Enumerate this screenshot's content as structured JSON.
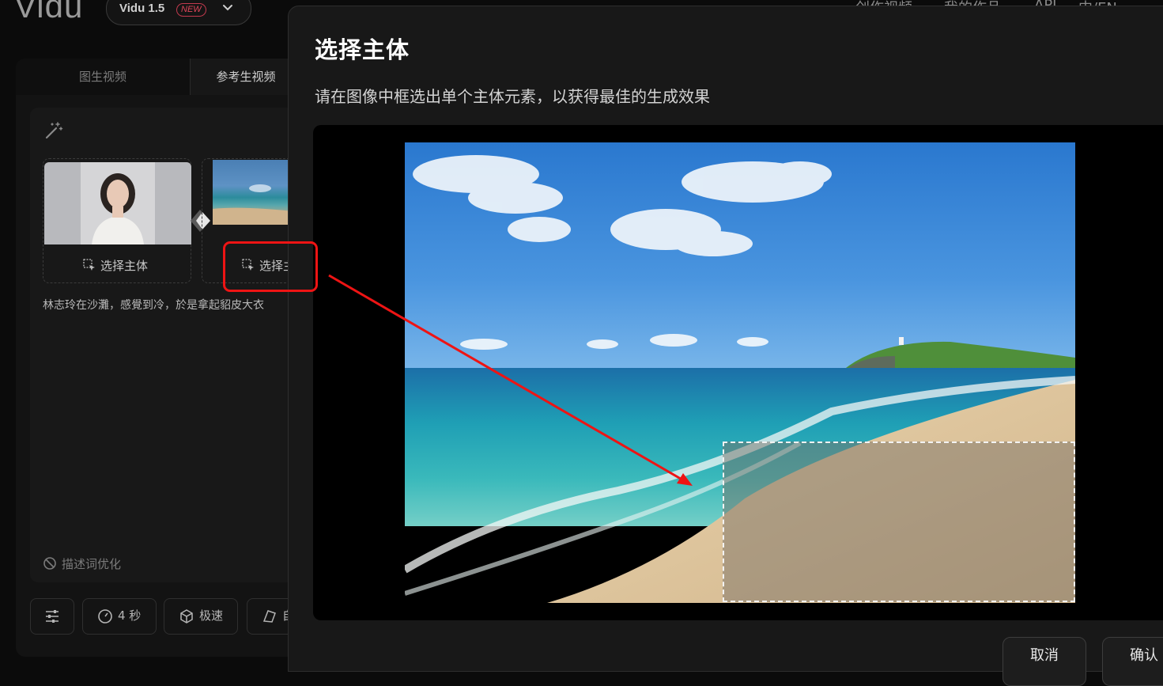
{
  "app": {
    "logo": "Vidu",
    "model": {
      "name": "Vidu 1.5",
      "badge": "NEW"
    },
    "nav_right": [
      "创作视频",
      "我的作品",
      "API",
      "中/EN"
    ]
  },
  "left_panel": {
    "tabs": [
      {
        "label": "图生视频",
        "active": false
      },
      {
        "label": "参考生视频",
        "active": true
      }
    ],
    "subjects": [
      {
        "select_label": "选择主体",
        "image": "portrait-woman"
      },
      {
        "select_label": "选择主体",
        "image": "beach-thumbnail"
      }
    ],
    "prompt": "林志玲在沙灘，感覺到冷，於是拿起貂皮大衣",
    "prompt_optimize": "描述词优化",
    "settings": [
      {
        "icon": "sliders-icon",
        "label": ""
      },
      {
        "icon": "timer-icon",
        "label": "4 秒"
      },
      {
        "icon": "cube-icon",
        "label": "极速"
      },
      {
        "icon": "aspect-icon",
        "label": "自"
      }
    ]
  },
  "modal": {
    "title": "选择主体",
    "subtitle": "请在图像中框选出单个主体元素，以获得最佳的生成效果",
    "cancel_label": "取消",
    "confirm_label": "确认"
  },
  "colors": {
    "accent_red": "#ee1414",
    "modal_bg": "#181818",
    "page_bg": "#0b0b0b"
  }
}
